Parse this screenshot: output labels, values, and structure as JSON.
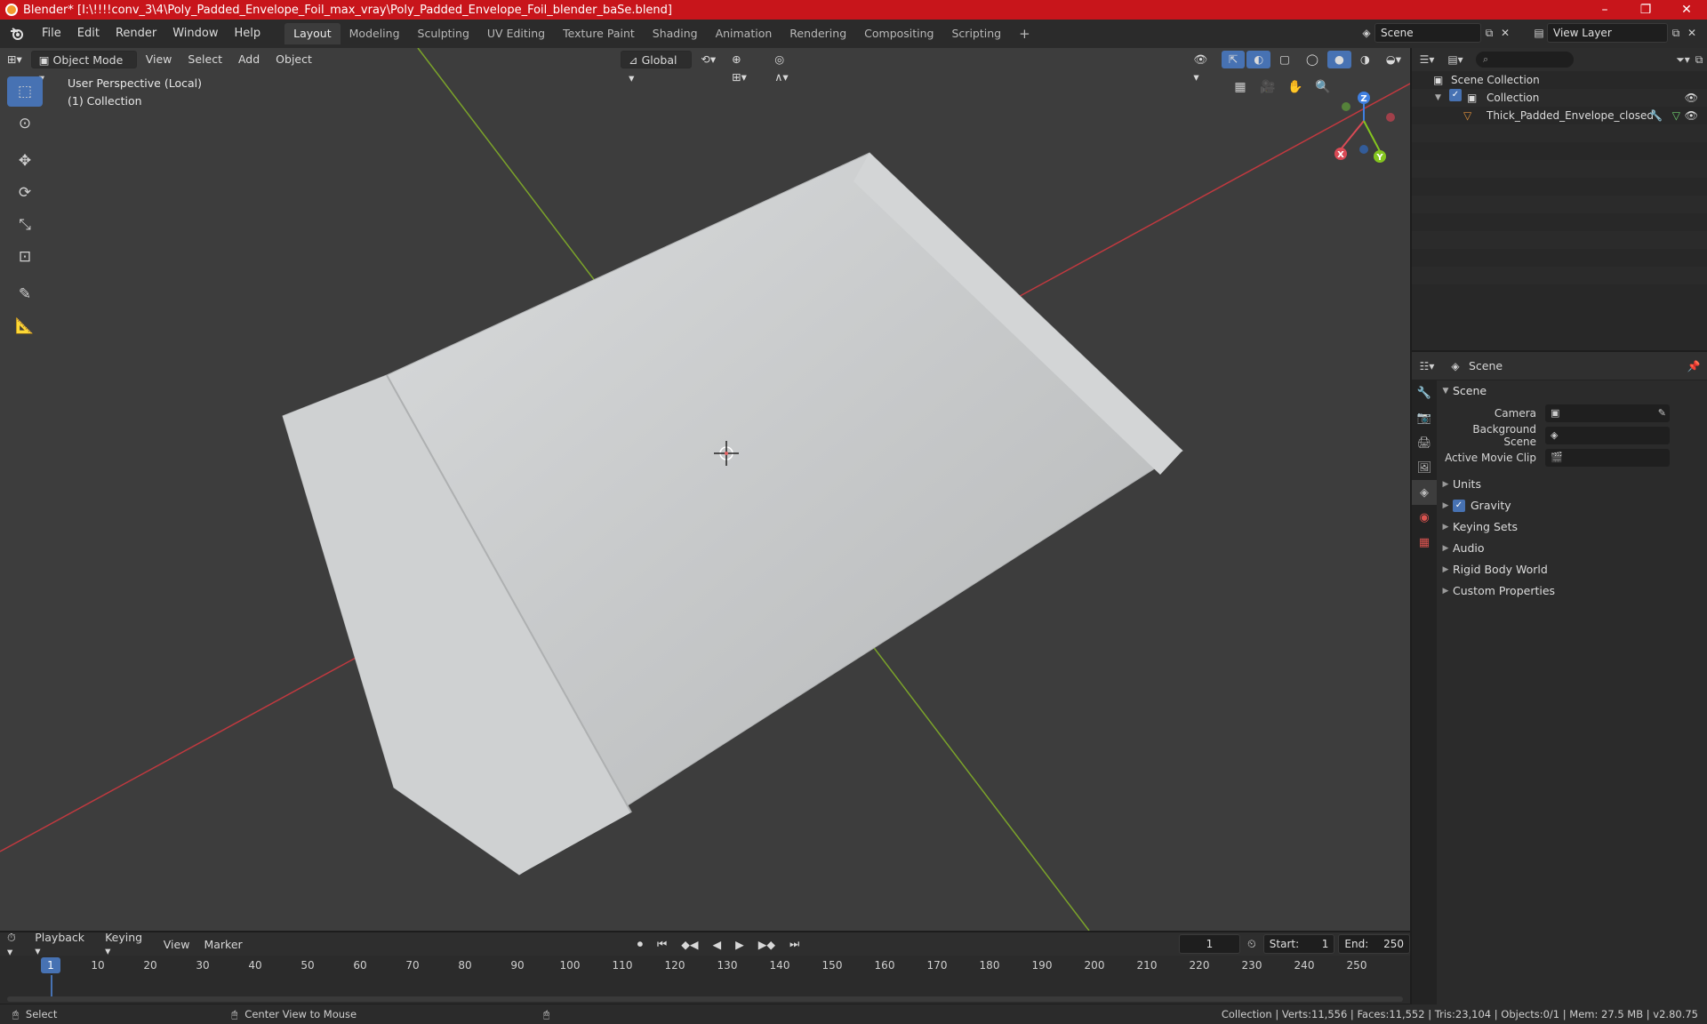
{
  "window": {
    "title": "Blender* [I:\\!!!!conv_3\\4\\Poly_Padded_Envelope_Foil_max_vray\\Poly_Padded_Envelope_Foil_blender_baSe.blend]",
    "minimize": "–",
    "maximize": "❐",
    "close": "✕"
  },
  "menubar": {
    "menus": [
      "File",
      "Edit",
      "Render",
      "Window",
      "Help"
    ],
    "workspaces": [
      "Layout",
      "Modeling",
      "Sculpting",
      "UV Editing",
      "Texture Paint",
      "Shading",
      "Animation",
      "Rendering",
      "Compositing",
      "Scripting"
    ],
    "active_workspace": "Layout",
    "add_workspace": "+",
    "scene": "Scene",
    "view_layer": "View Layer"
  },
  "viewport": {
    "mode": "Object Mode",
    "menus": [
      "View",
      "Select",
      "Add",
      "Object"
    ],
    "transform_orientation": "Global",
    "perspective_label": "User Perspective (Local)",
    "collection_label": "(1) Collection",
    "gizmo_axes": {
      "x": "X",
      "y": "Y",
      "z": "Z"
    },
    "colors": {
      "background": "#3d3d3d",
      "x_axis": "#c0393f",
      "y_axis": "#7ba32a",
      "active": "#4772b3"
    }
  },
  "outliner": {
    "search_placeholder": "",
    "root": "Scene Collection",
    "collection": "Collection",
    "object": "Thick_Padded_Envelope_closed"
  },
  "properties": {
    "context": "Scene",
    "panel_title": "Scene",
    "fields": [
      {
        "label": "Camera",
        "value": ""
      },
      {
        "label": "Background Scene",
        "value": ""
      },
      {
        "label": "Active Movie Clip",
        "value": ""
      }
    ],
    "subpanels": [
      "Units",
      "Gravity",
      "Keying Sets",
      "Audio",
      "Rigid Body World",
      "Custom Properties"
    ],
    "gravity_checked": true
  },
  "timeline": {
    "menus": [
      "Playback",
      "Keying",
      "View",
      "Marker"
    ],
    "current_frame": "1",
    "start_label": "Start:",
    "start": "1",
    "end_label": "End:",
    "end": "250",
    "ticks": [
      "10",
      "20",
      "30",
      "40",
      "50",
      "60",
      "70",
      "80",
      "90",
      "100",
      "110",
      "120",
      "130",
      "140",
      "150",
      "160",
      "170",
      "180",
      "190",
      "200",
      "210",
      "220",
      "230",
      "240",
      "250"
    ],
    "ruler_current": "1"
  },
  "statusbar": {
    "left_action": "Select",
    "middle_action": "Center View to Mouse",
    "stats": "Collection | Verts:11,556 | Faces:11,552 | Tris:23,104 | Objects:0/1 | Mem: 27.5 MB | v2.80.75"
  }
}
